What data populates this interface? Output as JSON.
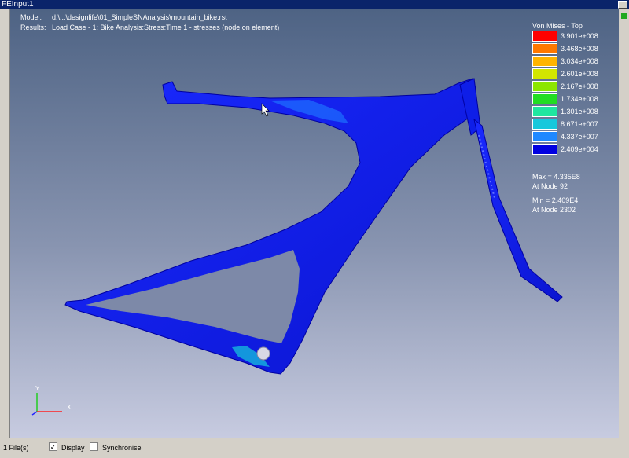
{
  "window": {
    "title": "FEInput1"
  },
  "info": {
    "model_label": "Model:",
    "model_value": "d:\\...\\designlife\\01_SimpleSNAnalysis\\mountain_bike.rst",
    "results_label": "Results:",
    "results_value": "Load Case - 1: Bike Analysis:Stress:Time 1 - stresses (node on element)"
  },
  "legend": {
    "title": "Von Mises - Top",
    "colors": [
      "#ff0000",
      "#ff7800",
      "#ffb400",
      "#d2e600",
      "#8ce600",
      "#22dd22",
      "#20e6a0",
      "#16c8dc",
      "#1e88ff",
      "#0000e0"
    ],
    "values": [
      "3.901e+008",
      "3.468e+008",
      "3.034e+008",
      "2.601e+008",
      "2.167e+008",
      "1.734e+008",
      "1.301e+008",
      "8.671e+007",
      "4.337e+007",
      "2.409e+004"
    ],
    "max": "Max = 4.335E8",
    "max_node": "At Node 92",
    "min": "Min = 2.409E4",
    "min_node": "At Node 2302"
  },
  "axes": {
    "x_label": "X",
    "y_label": "Y"
  },
  "status": {
    "files": "1 File(s)",
    "display_label": "Display",
    "display_checked": true,
    "synchronise_label": "Synchronise",
    "synchronise_checked": false
  }
}
